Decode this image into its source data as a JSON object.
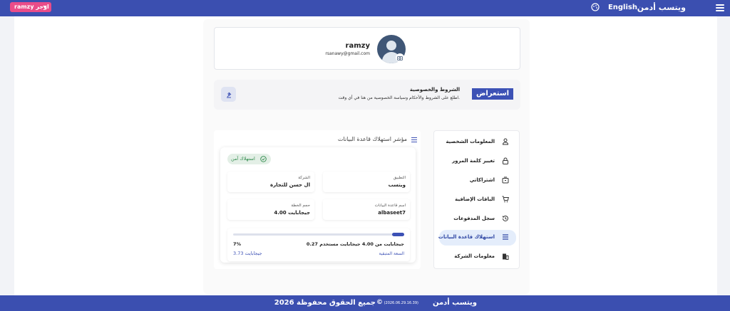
{
  "topbar": {
    "brand": "ويتسب أدمن",
    "language": "English",
    "user_button": "ramzy اوجر"
  },
  "profile": {
    "name": "ramzy",
    "email": "rsanawy@gmail.com"
  },
  "terms": {
    "button": "استعراض",
    "title": "الشروط والخصوصية",
    "description": "اطلع على الشروط والأحكام وسياسة الخصوصية من هنا في أي وقت."
  },
  "sidebar": {
    "items": [
      {
        "label": "المعلومات الشخصية",
        "icon": "person-icon"
      },
      {
        "label": "تغيير كلمة المرور",
        "icon": "lock-icon"
      },
      {
        "label": "اشتراكاتي",
        "icon": "subscription-icon"
      },
      {
        "label": "الباقات الإضافية",
        "icon": "cart-plus-icon"
      },
      {
        "label": "سجل المدفوعات",
        "icon": "history-icon"
      },
      {
        "label": "استهلاك قاعدة البيانات",
        "icon": "list-icon",
        "active": true
      },
      {
        "label": "معلومات الشركة",
        "icon": "building-icon"
      }
    ]
  },
  "usage_panel": {
    "title": "مؤشر استهلاك قاعدة البيانات",
    "status_badge": "استهلاك آمن",
    "fields": {
      "app_key": "التطبيق",
      "app_value": "ويتسب",
      "company_key": "الشركة",
      "company_value": "ال حسن للتجارة",
      "db_key": "اسم قاعدة البيانات",
      "db_value": "albaseet7",
      "plan_key": "حجم الخطة",
      "plan_value": "4.00 جيجابايت"
    },
    "used_text": "0.27 جيجابايت من 4.00 جيجابايت مستخدم",
    "percent_text": "7%",
    "percent": 7,
    "remaining_label": "السعة المتبقية",
    "remaining_value": "3.73 جيجابايت"
  },
  "footer": {
    "brand": "ويتسب أدمن",
    "version": "(2026.06.29.16.39)",
    "copyright": "©",
    "rights": "جميع الحقوق محفوظة 2026"
  },
  "colors": {
    "primary": "#3b4fb0",
    "accent_pink": "#ea4c89",
    "safe_green": "#2f8a4b"
  }
}
